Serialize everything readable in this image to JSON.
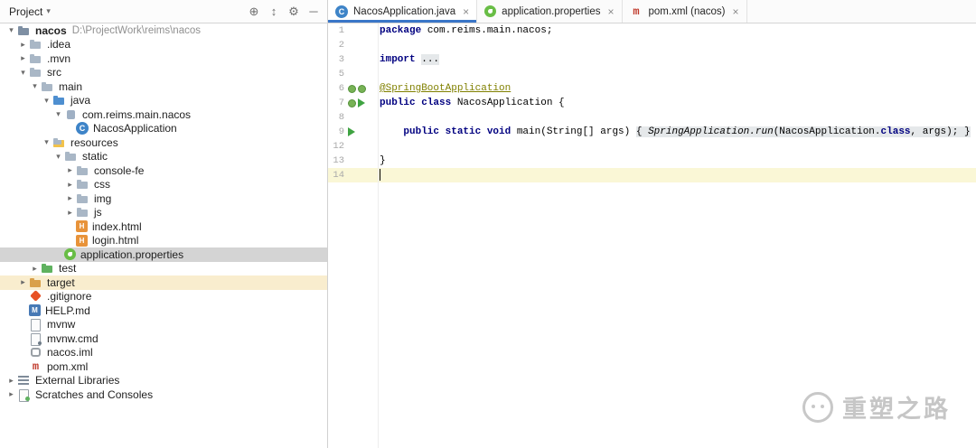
{
  "window": {
    "panel_title": "Project",
    "panel_icons": [
      {
        "name": "locate",
        "glyph": "⊕"
      },
      {
        "name": "collapse-all",
        "glyph": "↕"
      },
      {
        "name": "settings-gear",
        "glyph": "⚙"
      },
      {
        "name": "hide-panel",
        "glyph": "─"
      }
    ]
  },
  "tabs": [
    {
      "label": "NacosApplication.java",
      "icon": "java-class",
      "active": true,
      "close": "×"
    },
    {
      "label": "application.properties",
      "icon": "spring",
      "active": false,
      "close": "×"
    },
    {
      "label": "pom.xml (nacos)",
      "icon": "maven",
      "active": false,
      "close": "×"
    }
  ],
  "tree": [
    {
      "label": "nacos",
      "hint": "D:\\ProjectWork\\reims\\nacos",
      "level": 0,
      "icon": "folder-project",
      "arrow": "open",
      "bold": true
    },
    {
      "label": ".idea",
      "level": 1,
      "icon": "folder",
      "arrow": "closed"
    },
    {
      "label": ".mvn",
      "level": 1,
      "icon": "folder",
      "arrow": "closed"
    },
    {
      "label": "src",
      "level": 1,
      "icon": "folder",
      "arrow": "open"
    },
    {
      "label": "main",
      "level": 2,
      "icon": "folder",
      "arrow": "open"
    },
    {
      "label": "java",
      "level": 3,
      "icon": "folder-source",
      "arrow": "open"
    },
    {
      "label": "com.reims.main.nacos",
      "level": 4,
      "icon": "package",
      "arrow": "open"
    },
    {
      "label": "NacosApplication",
      "level": 5,
      "icon": "class"
    },
    {
      "label": "resources",
      "level": 3,
      "icon": "folder-resources",
      "arrow": "open"
    },
    {
      "label": "static",
      "level": 4,
      "icon": "folder",
      "arrow": "open"
    },
    {
      "label": "console-fe",
      "level": 5,
      "icon": "folder",
      "arrow": "closed"
    },
    {
      "label": "css",
      "level": 5,
      "icon": "folder",
      "arrow": "closed"
    },
    {
      "label": "img",
      "level": 5,
      "icon": "folder",
      "arrow": "closed"
    },
    {
      "label": "js",
      "level": 5,
      "icon": "folder",
      "arrow": "closed"
    },
    {
      "label": "index.html",
      "level": 5,
      "icon": "html"
    },
    {
      "label": "login.html",
      "level": 5,
      "icon": "html"
    },
    {
      "label": "application.properties",
      "level": 4,
      "icon": "spring",
      "selected": true
    },
    {
      "label": "test",
      "level": 2,
      "icon": "folder-test",
      "arrow": "closed"
    },
    {
      "label": "target",
      "level": 1,
      "icon": "folder-excluded",
      "arrow": "closed",
      "rowHighlight": true
    },
    {
      "label": ".gitignore",
      "level": 1,
      "icon": "gitignore"
    },
    {
      "label": "HELP.md",
      "level": 1,
      "icon": "markdown"
    },
    {
      "label": "mvnw",
      "level": 1,
      "icon": "file"
    },
    {
      "label": "mvnw.cmd",
      "level": 1,
      "icon": "cmd"
    },
    {
      "label": "nacos.iml",
      "level": 1,
      "icon": "iml"
    },
    {
      "label": "pom.xml",
      "level": 1,
      "icon": "maven"
    },
    {
      "label": "External Libraries",
      "level": 0,
      "icon": "libraries",
      "arrow": "closed"
    },
    {
      "label": "Scratches and Consoles",
      "level": 0,
      "icon": "scratches",
      "arrow": "closed"
    }
  ],
  "editor": {
    "lines": [
      {
        "n": "1",
        "seg": [
          [
            "package ",
            "kw"
          ],
          [
            "com.reims.main.nacos;",
            "pl"
          ]
        ]
      },
      {
        "n": "2",
        "seg": []
      },
      {
        "n": "3",
        "seg": [
          [
            "import ",
            "kw"
          ],
          [
            "...",
            "fold"
          ]
        ]
      },
      {
        "n": "5",
        "seg": []
      },
      {
        "n": "6",
        "seg": [
          [
            "@SpringBootApplication",
            "ann"
          ]
        ],
        "gutter": [
          "spring",
          "spring"
        ]
      },
      {
        "n": "7",
        "seg": [
          [
            "public class ",
            "kw"
          ],
          [
            "NacosApplication {",
            "pl"
          ]
        ],
        "gutter": [
          "spring",
          "run"
        ]
      },
      {
        "n": "8",
        "seg": []
      },
      {
        "n": "9",
        "seg": [
          [
            "    ",
            "pl"
          ],
          [
            "public static void ",
            "kw"
          ],
          [
            "main(String[] args) ",
            "pl"
          ],
          [
            "{ ",
            "fold"
          ],
          [
            "SpringApplication.run",
            "fold-it"
          ],
          [
            "(NacosApplication.",
            "fold"
          ],
          [
            "class",
            "fold-kw"
          ],
          [
            ", args); ",
            "fold"
          ],
          [
            "}",
            "fold"
          ]
        ],
        "gutter": [
          "run"
        ]
      },
      {
        "n": "12",
        "seg": []
      },
      {
        "n": "13",
        "seg": [
          [
            "}",
            "pl"
          ]
        ]
      },
      {
        "n": "14",
        "seg": [],
        "caret": true,
        "current": true
      }
    ]
  },
  "watermark": {
    "text": "重塑之路"
  }
}
